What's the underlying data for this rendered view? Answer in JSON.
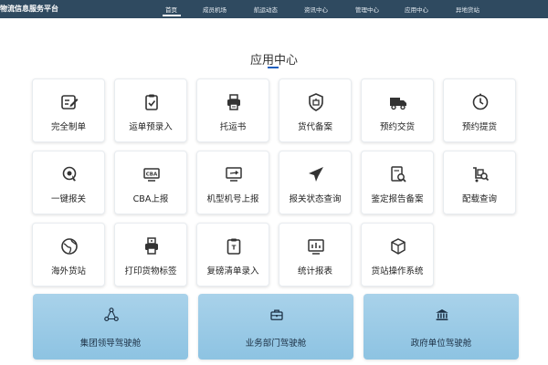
{
  "header": {
    "brand": "物流信息服务平台",
    "nav": [
      "首页",
      "成员机场",
      "航运动态",
      "资讯中心",
      "管理中心",
      "应用中心",
      "异地货站"
    ],
    "active_nav": "首页"
  },
  "main": {
    "section_title": "应用中心",
    "tiles": [
      {
        "label": "完全制单",
        "icon": "document-edit-icon"
      },
      {
        "label": "运单预录入",
        "icon": "clipboard-check-icon"
      },
      {
        "label": "托运书",
        "icon": "printer-icon"
      },
      {
        "label": "货代备案",
        "icon": "shield-badge-icon"
      },
      {
        "label": "预约交货",
        "icon": "delivery-truck-icon"
      },
      {
        "label": "预约提货",
        "icon": "clock-icon"
      },
      {
        "label": "一键报关",
        "icon": "globe-touch-icon"
      },
      {
        "label": "CBA上报",
        "icon": "cba-monitor-icon"
      },
      {
        "label": "机型机号上报",
        "icon": "monitor-plane-icon"
      },
      {
        "label": "报关状态查询",
        "icon": "airplane-icon"
      },
      {
        "label": "鉴定报告备案",
        "icon": "report-search-icon"
      },
      {
        "label": "配载查询",
        "icon": "cart-search-icon"
      },
      {
        "label": "海外货站",
        "icon": "world-globe-icon"
      },
      {
        "label": "打印货物标签",
        "icon": "label-printer-icon"
      },
      {
        "label": "复磅清单录入",
        "icon": "clipboard-list-icon"
      },
      {
        "label": "统计报表",
        "icon": "chart-screen-icon"
      },
      {
        "label": "货站操作系统",
        "icon": "package-box-icon"
      }
    ],
    "cockpits": [
      {
        "label": "集团领导驾驶舱",
        "icon": "network-nodes-icon"
      },
      {
        "label": "业务部门驾驶舱",
        "icon": "briefcase-icon"
      },
      {
        "label": "政府单位驾驶舱",
        "icon": "government-building-icon"
      }
    ]
  }
}
